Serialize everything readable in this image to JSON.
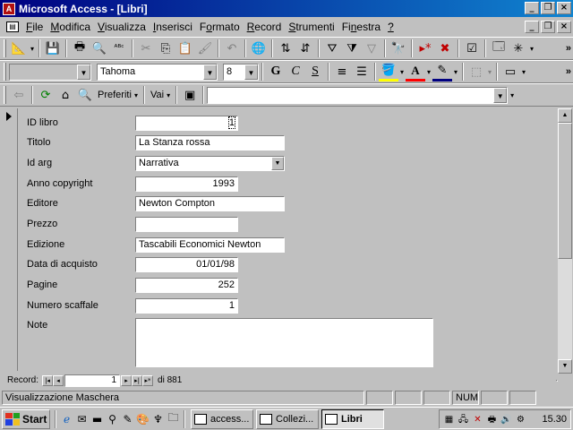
{
  "window": {
    "title": "Microsoft Access - [Libri]"
  },
  "menu": [
    {
      "label": "File",
      "key": "F"
    },
    {
      "label": "Modifica",
      "key": "M"
    },
    {
      "label": "Visualizza",
      "key": "V"
    },
    {
      "label": "Inserisci",
      "key": "I"
    },
    {
      "label": "Formato",
      "key": "o"
    },
    {
      "label": "Record",
      "key": "R"
    },
    {
      "label": "Strumenti",
      "key": "S"
    },
    {
      "label": "Finestra",
      "key": "n"
    },
    {
      "label": "?",
      "key": "?"
    }
  ],
  "format_toolbar": {
    "object_value": "",
    "font_name": "Tahoma",
    "font_size": "8",
    "bold": "G",
    "italic": "C",
    "underline": "S"
  },
  "web_toolbar": {
    "favorites": "Preferiti",
    "go": "Vai",
    "address_value": ""
  },
  "form": {
    "fields": [
      {
        "label": "ID libro",
        "value": "1"
      },
      {
        "label": "Titolo",
        "value": "La Stanza rossa"
      },
      {
        "label": "Id arg",
        "value": "Narrativa"
      },
      {
        "label": "Anno copyright",
        "value": "1993"
      },
      {
        "label": "Editore",
        "value": "Newton Compton"
      },
      {
        "label": "Prezzo",
        "value": ""
      },
      {
        "label": "Edizione",
        "value": "Tascabili Economici Newton"
      },
      {
        "label": "Data di acquisto",
        "value": "01/01/98"
      },
      {
        "label": "Pagine",
        "value": "252"
      },
      {
        "label": "Numero scaffale",
        "value": "1"
      },
      {
        "label": "Note",
        "value": ""
      }
    ]
  },
  "record_nav": {
    "label": "Record:",
    "current": "1",
    "total_text": "di 881"
  },
  "status": {
    "text": "Visualizzazione Maschera",
    "num": "NUM"
  },
  "taskbar": {
    "start": "Start",
    "tasks": [
      "access...",
      "Collezi...",
      "Libri"
    ],
    "clock": "15.30"
  }
}
